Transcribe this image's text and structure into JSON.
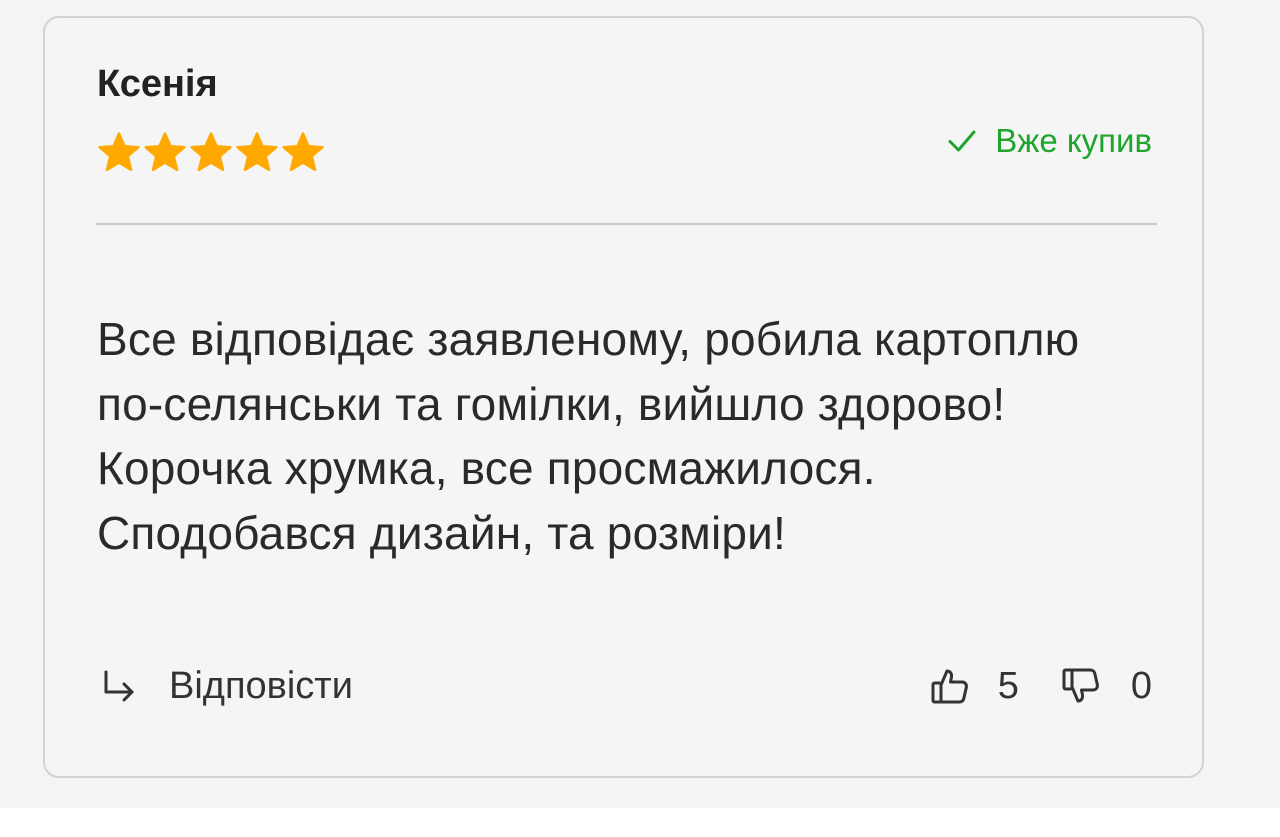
{
  "review": {
    "author": "Ксенія",
    "rating": 5,
    "rating_max": 5,
    "purchased_label": "Вже купив",
    "text": "Все відповідає заявленому, робила картоплю по-селянськи та гомілки, вийшло здорово! Корочка хрумка, все просмажилося. Сподобався дизайн, та розміри!",
    "reply_label": "Відповісти",
    "likes": "5",
    "dislikes": "0"
  },
  "icons": {
    "star": "star-icon",
    "check": "check-icon",
    "reply": "reply-arrow-icon",
    "like": "thumbs-up-icon",
    "dislike": "thumbs-down-icon"
  },
  "colors": {
    "star": "#ffa900",
    "purchased": "#1ea52e",
    "text": "#2a2a2a",
    "border": "#d2d2d2"
  }
}
